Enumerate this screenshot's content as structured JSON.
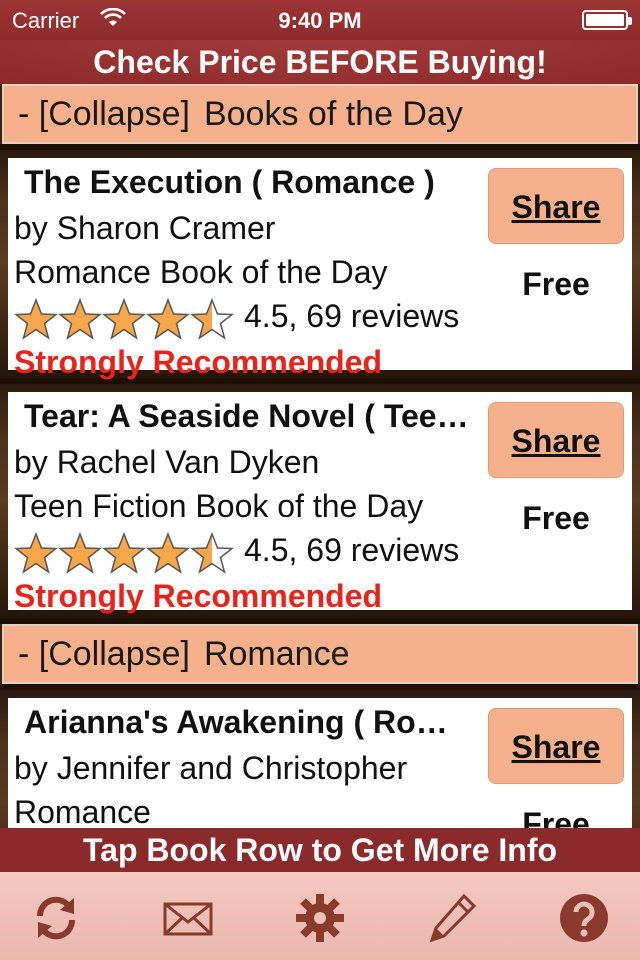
{
  "status_bar": {
    "carrier": "Carrier",
    "time": "9:40 PM"
  },
  "top_banner": "Check Price BEFORE Buying!",
  "sections": [
    {
      "collapse_label": "- [Collapse]",
      "title": "Books of the Day",
      "books": [
        {
          "title": "The Execution ( Romance )",
          "author": "by Sharon Cramer",
          "category": "Romance Book of the Day",
          "rating": 4.5,
          "rating_text": "4.5, 69 reviews",
          "recommendation": "Strongly Recommended",
          "share_label": "Share",
          "price": "Free"
        },
        {
          "title": "Tear: A Seaside Novel ( Teen Fiction )",
          "author": "by Rachel Van Dyken",
          "category": "Teen Fiction Book of the Day",
          "rating": 4.5,
          "rating_text": "4.5, 69 reviews",
          "recommendation": "Strongly Recommended",
          "share_label": "Share",
          "price": "Free"
        }
      ]
    },
    {
      "collapse_label": "- [Collapse]",
      "title": "Romance",
      "books": [
        {
          "title": "Arianna's Awakening ( Romance )",
          "author": "by Jennifer and Christopher",
          "category": "Romance",
          "share_label": "Share",
          "price": "Free"
        }
      ]
    }
  ],
  "bottom_banner": "Tap Book Row to Get More Info",
  "toolbar": [
    "refresh-icon",
    "mail-icon",
    "gear-icon",
    "pencil-icon",
    "help-icon"
  ],
  "colors": {
    "accent": "#f7b08c",
    "banner": "#8a2a2a",
    "recommend": "#e8231c"
  }
}
